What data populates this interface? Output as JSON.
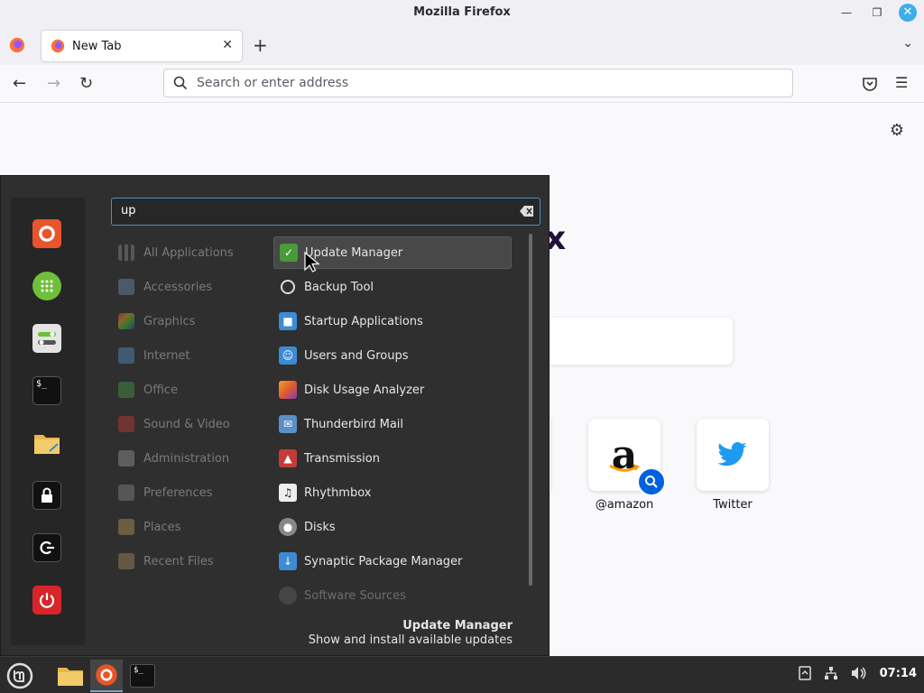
{
  "window": {
    "title": "Mozilla Firefox"
  },
  "tabs": {
    "active_tab_title": "New Tab"
  },
  "urlbar": {
    "placeholder": "Search or enter address"
  },
  "newtab": {
    "tiles": [
      {
        "label": "@amazon"
      },
      {
        "label": "Twitter"
      }
    ]
  },
  "menu": {
    "search_value": "up",
    "categories": [
      "All Applications",
      "Accessories",
      "Graphics",
      "Internet",
      "Office",
      "Sound & Video",
      "Administration",
      "Preferences",
      "Places",
      "Recent Files"
    ],
    "apps": [
      "Update Manager",
      "Backup Tool",
      "Startup Applications",
      "Users and Groups",
      "Disk Usage Analyzer",
      "Thunderbird Mail",
      "Transmission",
      "Rhythmbox",
      "Disks",
      "Synaptic Package Manager",
      "Software Sources"
    ],
    "selected_app_title": "Update Manager",
    "selected_app_description": "Show and install available updates"
  },
  "taskbar": {
    "clock": "07:14"
  },
  "colors": {
    "accent": "#3daee9",
    "menu_bg": "#2f2f2f",
    "firefox_blue": "#0061e0"
  }
}
